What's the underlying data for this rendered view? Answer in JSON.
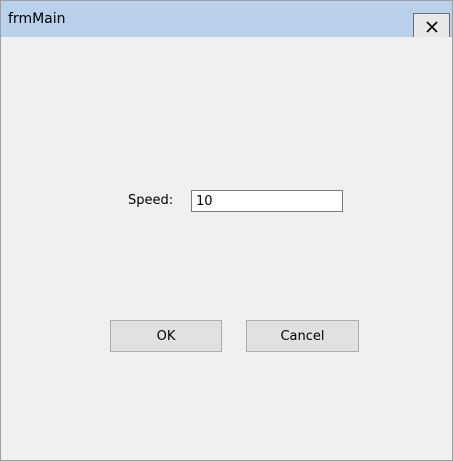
{
  "window": {
    "title": "frmMain",
    "close_icon": "close-icon"
  },
  "form": {
    "speed_label": "Speed:",
    "speed_value": "10",
    "ok_label": "OK",
    "cancel_label": "Cancel"
  },
  "colors": {
    "titlebar": "#b9d1ea",
    "client_background": "#f0f0f0",
    "button_face": "#e1e1e1"
  }
}
